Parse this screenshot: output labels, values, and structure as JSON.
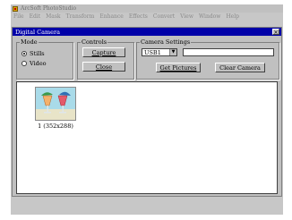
{
  "app": {
    "title": "ArcSoft PhotoStudio",
    "menu": [
      "File",
      "Edit",
      "Mask",
      "Transform",
      "Enhance",
      "Effects",
      "Convert",
      "View",
      "Window",
      "Help"
    ]
  },
  "dialog": {
    "title": "Digital Camera",
    "close_symbol": "×",
    "mode": {
      "label": "Mode",
      "options": [
        "Stills",
        "Video"
      ],
      "selected": "Stills"
    },
    "controls": {
      "label": "Controls",
      "capture_label": "Capture",
      "close_label": "Close"
    },
    "camera_settings": {
      "label": "Camera Settings",
      "port_value": "USB1",
      "text_value": "",
      "get_pictures_label": "Get Pictures",
      "clear_camera_label": "Clear Camera"
    },
    "thumbnails": [
      {
        "caption": "1 (352x288)"
      }
    ]
  },
  "icons": {
    "app": "app-icon",
    "close": "close-icon",
    "dropdown": "chevron-down-icon"
  }
}
